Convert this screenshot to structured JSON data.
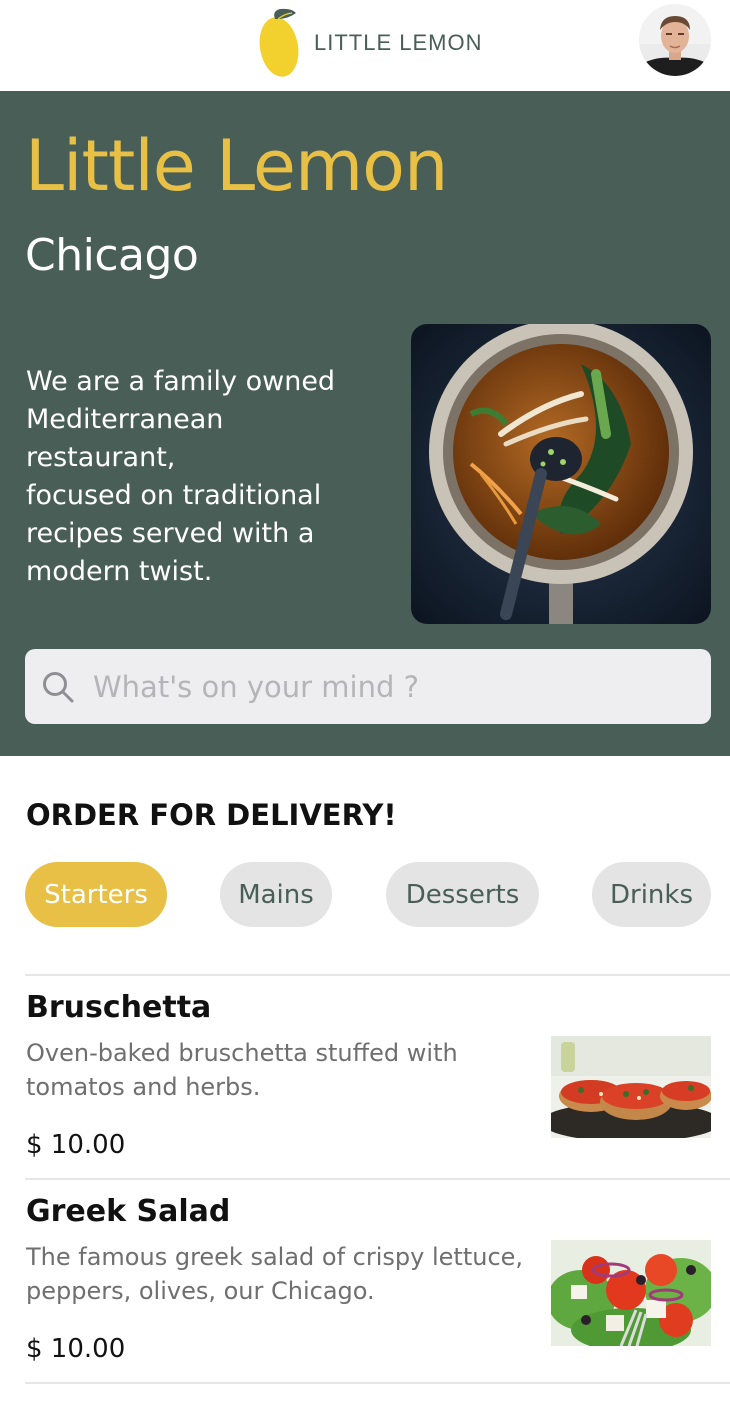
{
  "header": {
    "brand_name": "LITTLE LEMON",
    "logo_icon": "lemon-icon",
    "avatar_icon": "profile-avatar"
  },
  "hero": {
    "title": "Little Lemon",
    "city": "Chicago",
    "description": "We are a family owned\nMediterranean\nrestaurant,\nfocused on traditional\nrecipes served with a\nmodern twist.",
    "search": {
      "placeholder": "What's on your mind ?",
      "value": "",
      "icon": "search-icon"
    }
  },
  "delivery": {
    "title": "ORDER FOR DELIVERY!",
    "categories": [
      {
        "label": "Starters",
        "active": true
      },
      {
        "label": "Mains",
        "active": false
      },
      {
        "label": "Desserts",
        "active": false
      },
      {
        "label": "Drinks",
        "active": false
      }
    ]
  },
  "menu_items": [
    {
      "name": "Bruschetta",
      "description": "Oven-baked bruschetta stuffed with tomatos and herbs.",
      "price": "$ 10.00"
    },
    {
      "name": "Greek Salad",
      "description": "The famous greek salad of crispy lettuce, peppers, olives, our Chicago.",
      "price": "$ 10.00"
    }
  ],
  "colors": {
    "primary_green": "#495e57",
    "primary_yellow": "#e9c046",
    "chip_gray": "#e4e4e4"
  }
}
